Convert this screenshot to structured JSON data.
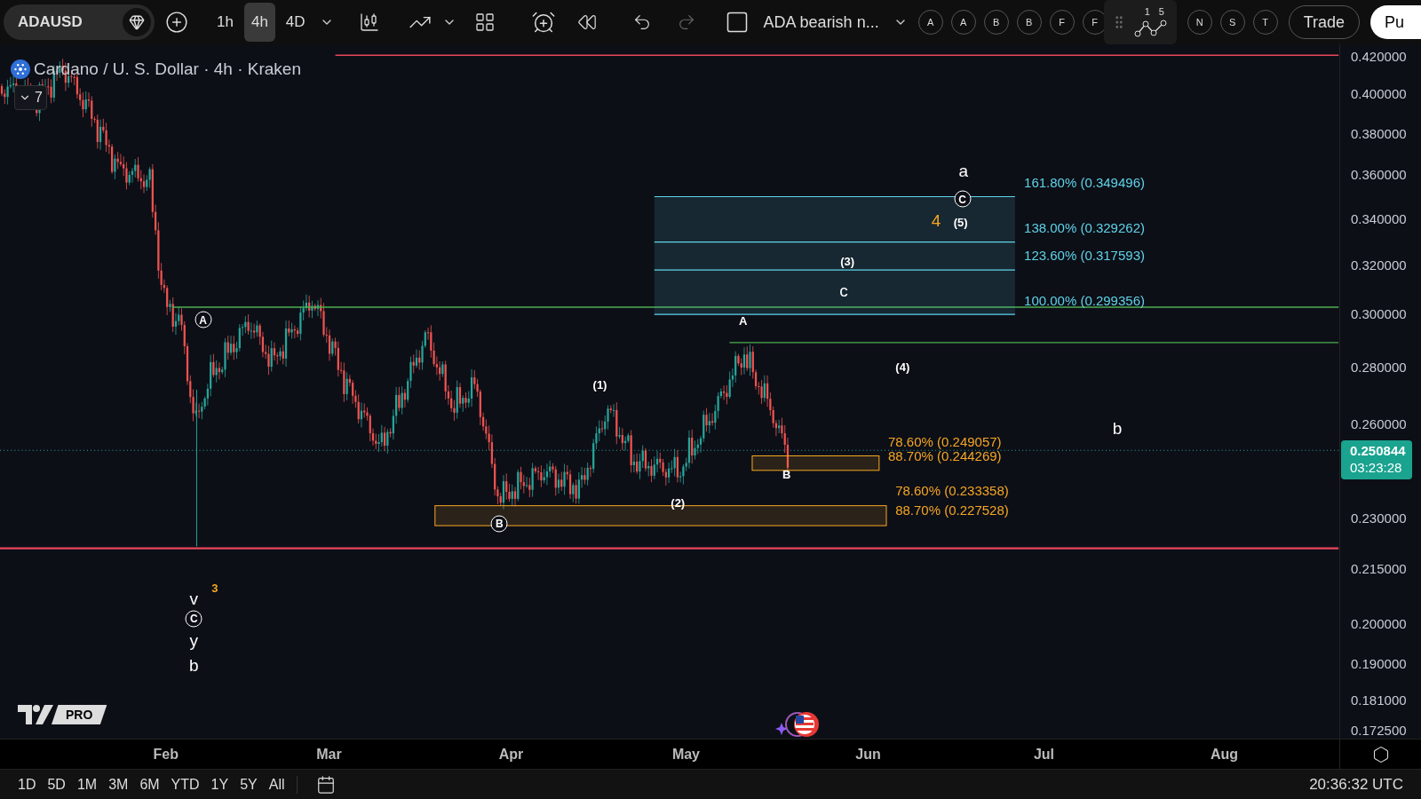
{
  "toolbar": {
    "symbol": "ADAUSD",
    "intervals": [
      {
        "label": "1h",
        "selected": false
      },
      {
        "label": "4h",
        "selected": true
      },
      {
        "label": "4D",
        "selected": false
      }
    ],
    "layout_name": "ADA bearish n...",
    "letter_tools": [
      "A",
      "A",
      "B",
      "B",
      "F",
      "F"
    ],
    "wave_tool": {
      "labels": [
        "1",
        "5"
      ]
    },
    "more_letter_tools": [
      "N",
      "S",
      "T"
    ],
    "trade": "Trade",
    "publish": "Pu"
  },
  "legend": {
    "title": "Cardano / U. S. Dollar · 4h · Kraken",
    "indicator_count": "7"
  },
  "fib_labels": [
    {
      "text": "161.80% (0.349496)",
      "color": "#5fd3e8"
    },
    {
      "text": "138.00% (0.329262)",
      "color": "#5fd3e8"
    },
    {
      "text": "123.60% (0.317593)",
      "color": "#5fd3e8"
    },
    {
      "text": "100.00% (0.299356)",
      "color": "#5fd3e8"
    },
    {
      "text": "78.60% (0.249057)",
      "color": "#f5a623"
    },
    {
      "text": "88.70% (0.244269)",
      "color": "#f5a623"
    },
    {
      "text": "78.60% (0.233358)",
      "color": "#f5a623"
    },
    {
      "text": "88.70% (0.227528)",
      "color": "#f5a623"
    }
  ],
  "wave_labels": [
    {
      "text": "a",
      "kind": "letter",
      "color": "#ffffff"
    },
    {
      "text": "C",
      "kind": "circled",
      "color": "#ffffff"
    },
    {
      "text": "4",
      "kind": "letter",
      "color": "#f5a623"
    },
    {
      "text": "(5)",
      "kind": "count",
      "color": "#ffffff"
    },
    {
      "text": "(3)",
      "kind": "count",
      "color": "#ffffff"
    },
    {
      "text": "c",
      "kind": "letter",
      "color": "#ffffff"
    },
    {
      "text": "A",
      "kind": "count",
      "color": "#ffffff"
    },
    {
      "text": "A",
      "kind": "circled",
      "color": "#ffffff"
    },
    {
      "text": "(4)",
      "kind": "count",
      "color": "#ffffff"
    },
    {
      "text": "(1)",
      "kind": "count",
      "color": "#ffffff"
    },
    {
      "text": "b",
      "kind": "letter",
      "color": "#ffffff"
    },
    {
      "text": "B",
      "kind": "count",
      "color": "#ffffff"
    },
    {
      "text": "(2)",
      "kind": "count",
      "color": "#ffffff"
    },
    {
      "text": "B",
      "kind": "circled",
      "color": "#ffffff"
    },
    {
      "text": "v",
      "kind": "letter",
      "color": "#ffffff"
    },
    {
      "text": "3",
      "kind": "count",
      "color": "#f5a623"
    },
    {
      "text": "C",
      "kind": "circled",
      "color": "#ffffff"
    },
    {
      "text": "y",
      "kind": "letter",
      "color": "#ffffff"
    },
    {
      "text": "b",
      "kind": "letter",
      "color": "#ffffff"
    }
  ],
  "price_axis": {
    "ticks": [
      "0.420000",
      "0.400000",
      "0.380000",
      "0.360000",
      "0.340000",
      "0.320000",
      "0.300000",
      "0.280000",
      "0.260000",
      "0.230000",
      "0.215000",
      "0.200000",
      "0.190000",
      "0.181000",
      "0.172500"
    ],
    "last_price": "0.250844",
    "countdown": "03:23:28"
  },
  "logo": "PRO",
  "time_axis": [
    "Feb",
    "Mar",
    "Apr",
    "May",
    "Jun",
    "Jul",
    "Aug"
  ],
  "ranges": [
    "1D",
    "5D",
    "1M",
    "3M",
    "6M",
    "YTD",
    "1Y",
    "5Y",
    "All"
  ],
  "clock": "20:36:32 UTC"
}
